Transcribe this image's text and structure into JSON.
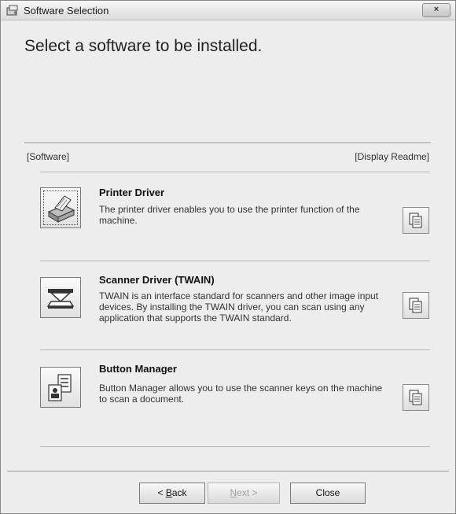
{
  "window": {
    "title": "Software Selection",
    "close_glyph": "×"
  },
  "heading": "Select a software to be installed.",
  "columns": {
    "left": "[Software]",
    "right": "[Display Readme]"
  },
  "items": [
    {
      "title": "Printer Driver",
      "desc": "The printer driver enables you to use the printer function of the machine.",
      "icon": "printer-icon"
    },
    {
      "title": "Scanner Driver (TWAIN)",
      "desc": "TWAIN is an interface standard for scanners and other image input devices. By installing the TWAIN driver, you can scan using any application that supports the TWAIN standard.",
      "icon": "scanner-icon"
    },
    {
      "title": "Button Manager",
      "desc": "Button Manager allows you to use the scanner keys on the machine to scan a document.",
      "icon": "button-manager-icon"
    }
  ],
  "buttons": {
    "back_prefix": "< ",
    "back_key": "B",
    "back_rest": "ack",
    "next_key": "N",
    "next_rest": "ext >",
    "close": "Close"
  }
}
